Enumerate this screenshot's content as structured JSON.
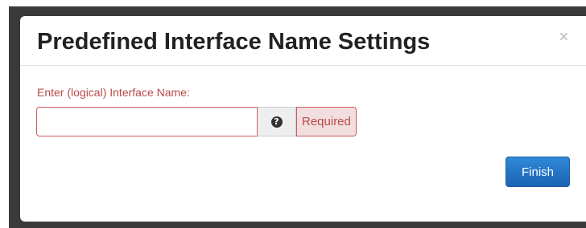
{
  "modal": {
    "title": "Predefined Interface Name Settings",
    "close_label": "×",
    "field": {
      "label": "Enter (logical) Interface Name:",
      "value": "",
      "placeholder": "",
      "help_icon": "question-circle-icon",
      "help_glyph": "?",
      "validation_text": "Required"
    },
    "finish_label": "Finish"
  },
  "colors": {
    "error": "#b94a48",
    "primary": "#2f8ad8"
  }
}
